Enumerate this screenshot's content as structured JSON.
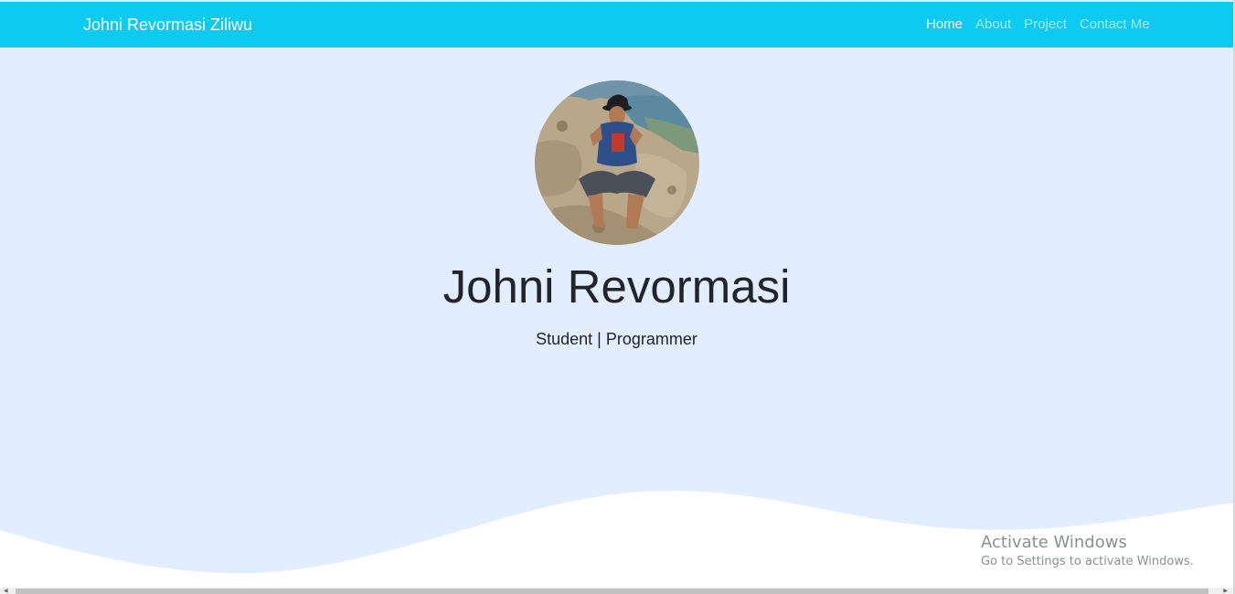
{
  "navbar": {
    "brand": "Johni Revormasi Ziliwu",
    "links": [
      {
        "label": "Home",
        "active": true
      },
      {
        "label": "About",
        "active": false
      },
      {
        "label": "Project",
        "active": false
      },
      {
        "label": "Contact Me",
        "active": false
      }
    ],
    "background": "#0dcaf0"
  },
  "hero": {
    "name": "Johni Revormasi",
    "subtitle": "Student | Programmer",
    "background": "#e2edff",
    "avatar_icon": "profile-photo"
  },
  "watermark": {
    "title": "Activate Windows",
    "subtitle": "Go to Settings to activate Windows."
  }
}
